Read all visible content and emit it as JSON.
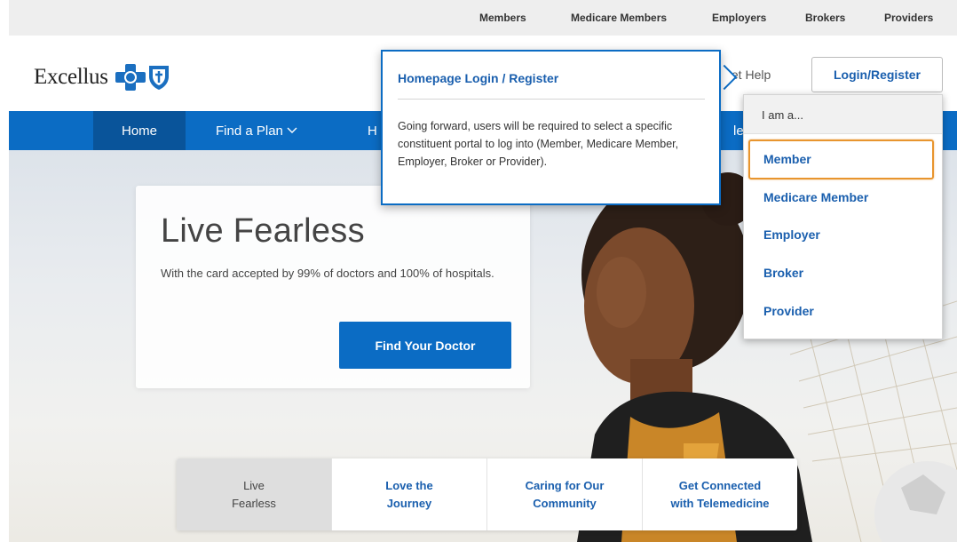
{
  "utility_nav": {
    "members": "Members",
    "medicare_members": "Medicare Members",
    "employers": "Employers",
    "brokers": "Brokers",
    "providers": "Providers"
  },
  "header": {
    "logo_text": "Excellus",
    "help_label": "Get Help",
    "login_label": "Login/Register"
  },
  "nav": {
    "home": "Home",
    "find_plan": "Find a Plan",
    "h_partial": "H",
    "hea_partial": "lea"
  },
  "hero": {
    "title": "Live Fearless",
    "subtitle": "With the card accepted by 99% of doctors and 100% of hospitals.",
    "cta_label": "Find Your Doctor"
  },
  "tabs": [
    {
      "label": "Live\nFearless"
    },
    {
      "label": "Love the\nJourney"
    },
    {
      "label": "Caring for Our\nCommunity"
    },
    {
      "label": "Get Connected\nwith Telemedicine"
    }
  ],
  "popup": {
    "title": "Homepage Login / Register",
    "body": "Going forward, users will be required to select a specific constituent portal to log into (Member, Medicare Member, Employer, Broker or Provider)."
  },
  "dropdown": {
    "header": "I am a...",
    "items": [
      "Member",
      "Medicare Member",
      "Employer",
      "Broker",
      "Provider"
    ],
    "selected": "Member"
  },
  "colors": {
    "brand_blue": "#0b6cc4",
    "nav_active": "#09549a",
    "link_blue": "#1a5fae",
    "focus_orange": "#e8952e"
  }
}
